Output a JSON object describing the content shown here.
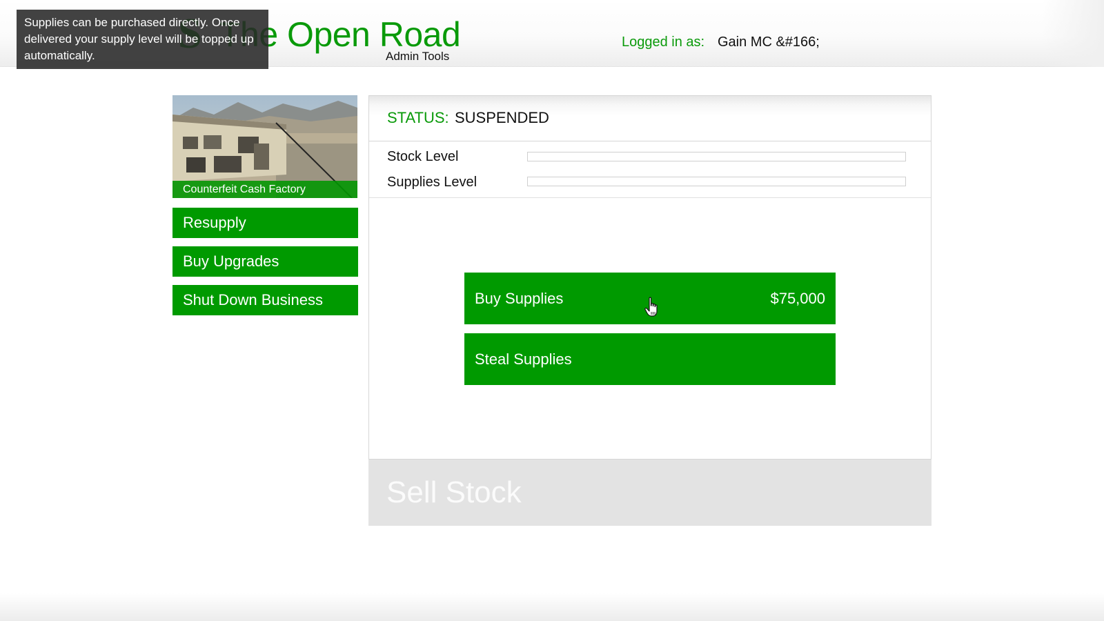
{
  "header": {
    "title": "The Open Road",
    "subtitle": "Admin Tools",
    "login_label": "Logged in as:",
    "login_user": "Gain MC &#166;"
  },
  "tooltip": {
    "text": "Supplies can be purchased directly. Once delivered your supply level will be topped up automatically."
  },
  "business": {
    "name": "Counterfeit Cash Factory"
  },
  "sidebar": {
    "items": [
      {
        "label": "Resupply"
      },
      {
        "label": "Buy Upgrades"
      },
      {
        "label": "Shut Down Business"
      }
    ]
  },
  "status": {
    "label": "STATUS:",
    "value": "SUSPENDED"
  },
  "levels": {
    "stock_label": "Stock Level",
    "stock_value": 0,
    "supplies_label": "Supplies Level",
    "supplies_value": 0
  },
  "actions": {
    "buy_label": "Buy Supplies",
    "buy_price": "$75,000",
    "steal_label": "Steal Supplies"
  },
  "sell": {
    "label": "Sell Stock"
  },
  "colors": {
    "accent": "#009a00",
    "title_green": "#0a9a0a",
    "sell_disabled": "#e3e3e3"
  },
  "icons": {
    "logo": "open-road-logo-icon",
    "cursor": "hand-pointer-icon"
  }
}
